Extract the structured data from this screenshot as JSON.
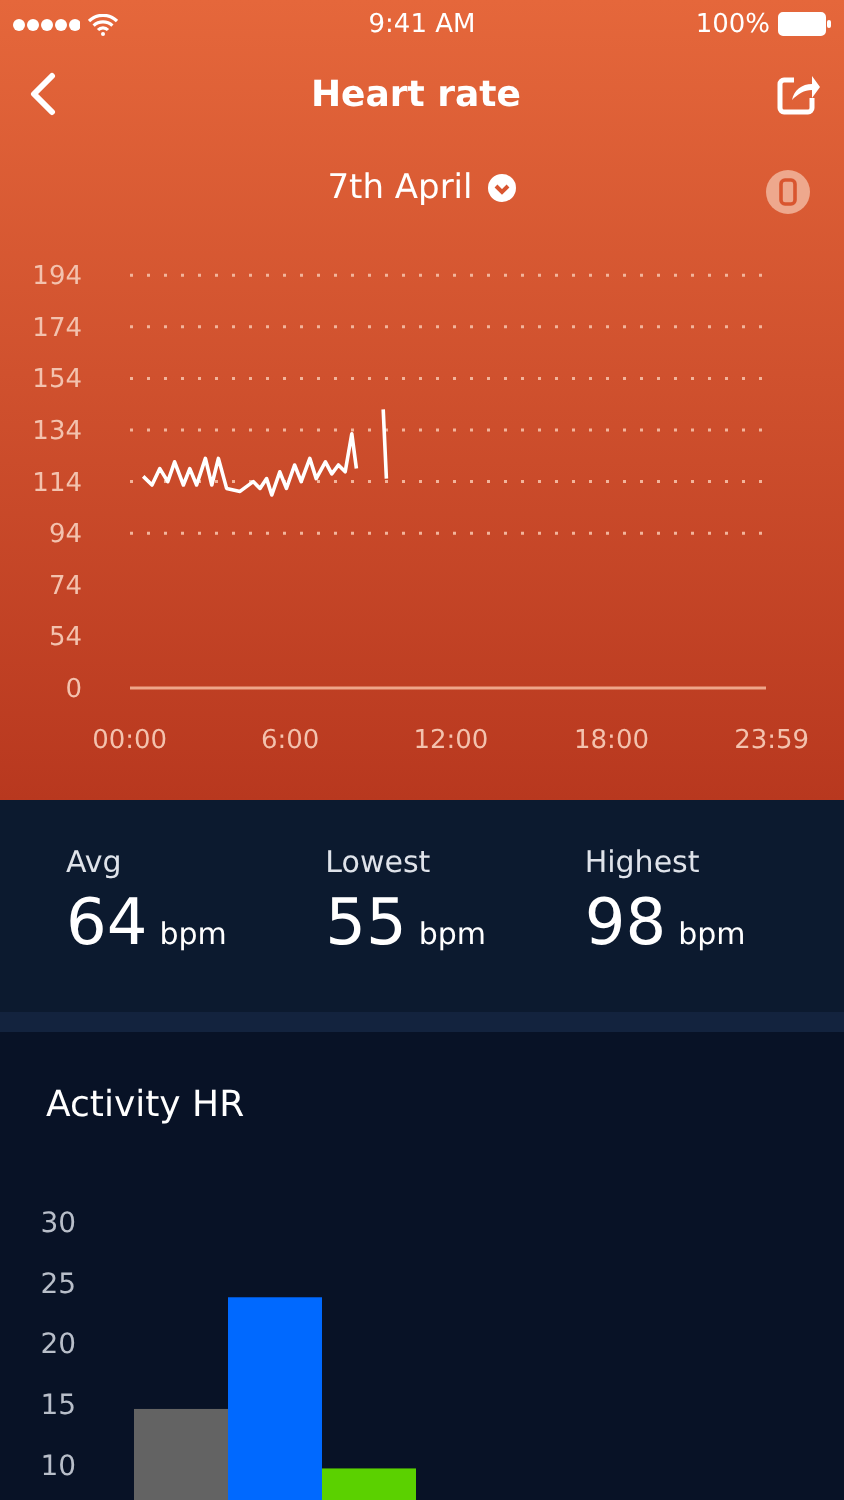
{
  "status_bar": {
    "time": "9:41 AM",
    "battery": "100%"
  },
  "nav": {
    "title": "Heart rate"
  },
  "date": {
    "label": "7th April"
  },
  "heart_chart": {
    "chart_data": {
      "type": "line",
      "x": [
        0.51,
        0.84,
        1.13,
        1.43,
        1.68,
        2.01,
        2.25,
        2.5,
        2.83,
        3.07,
        3.32,
        3.62,
        4.12,
        4.62,
        4.87,
        5.12,
        5.31,
        5.61,
        5.86,
        6.16,
        6.41,
        6.73,
        6.97,
        7.31,
        7.55,
        7.8,
        8.05,
        8.3,
        8.47,
        9.0,
        9.47,
        9.59
      ],
      "series": [
        {
          "color": "#ffffff",
          "values": [
            116,
            112.7,
            119,
            114,
            121.7,
            112.7,
            119,
            112.7,
            123,
            112.7,
            123,
            111.4,
            110.2,
            114,
            111.4,
            115.2,
            108.8,
            117.8,
            111.4,
            120.4,
            114,
            123,
            115.2,
            121.7,
            117,
            120.4,
            117.8,
            132.5,
            119,
            null,
            142,
            115.2
          ]
        }
      ],
      "xlim": [
        0,
        23.98
      ],
      "ylim": [
        34,
        194
      ],
      "grid": true,
      "xticks": [
        {
          "value": 0,
          "label": "00:00"
        },
        {
          "value": 6,
          "label": "6:00"
        },
        {
          "value": 12,
          "label": "12:00"
        },
        {
          "value": 18,
          "label": "18:00"
        },
        {
          "value": 23.98,
          "label": "23:59"
        }
      ],
      "yticks": [
        54,
        74,
        94,
        114,
        134,
        154,
        174,
        194
      ]
    },
    "baseline_label": "0"
  },
  "stats": [
    {
      "label": "Avg",
      "value": "64",
      "unit": "bpm"
    },
    {
      "label": "Lowest",
      "value": "55",
      "unit": "bpm"
    },
    {
      "label": "Highest",
      "value": "98",
      "unit": "bpm"
    }
  ],
  "activity": {
    "title": "Activity HR",
    "chart_data": {
      "type": "bar",
      "series": [
        {
          "color": "#636363",
          "values": [
            14.6
          ]
        },
        {
          "color": "#0069ff",
          "values": [
            23.8
          ]
        },
        {
          "color": "#5bd100",
          "values": [
            9.7
          ]
        }
      ],
      "ylim": [
        5.45,
        30
      ],
      "yticks": [
        10,
        15,
        20,
        25,
        30
      ]
    }
  }
}
